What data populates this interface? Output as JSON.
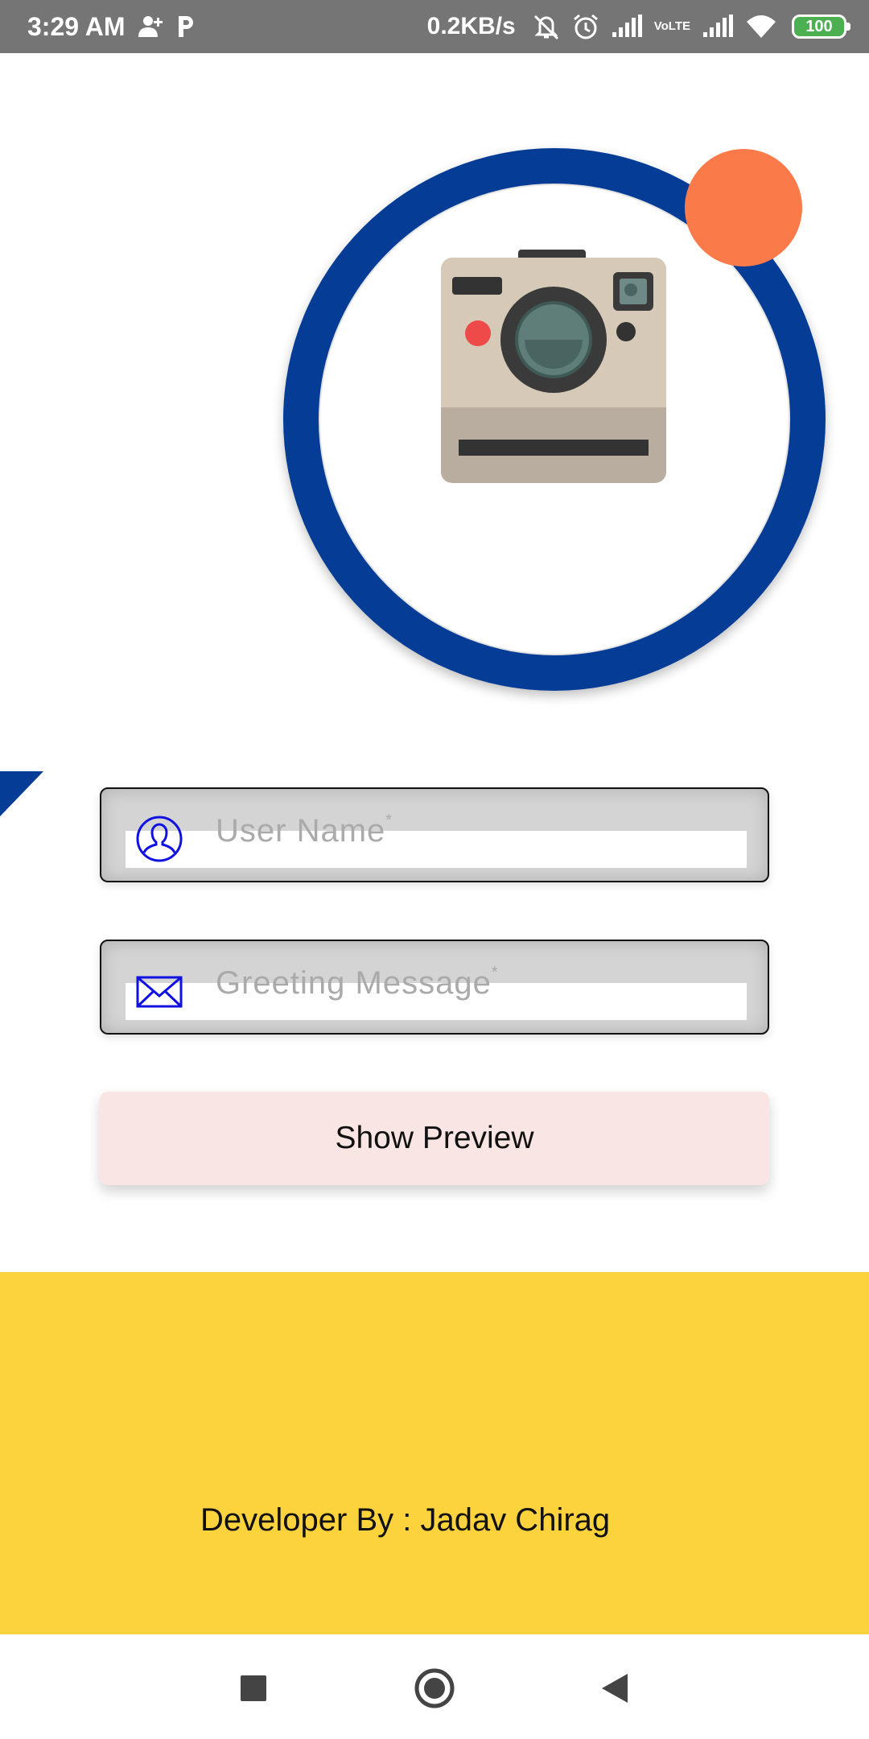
{
  "status_bar": {
    "time": "3:29 AM",
    "network_speed": "0.2KB/s",
    "volte_line1": "Vo",
    "volte_line2": "LTE",
    "battery": "100",
    "icons": [
      "add-user-icon",
      "p-icon",
      "mute-icon",
      "alarm-icon",
      "signal-icon",
      "volte-icon",
      "signal-icon",
      "wifi-icon",
      "battery-icon"
    ]
  },
  "hero": {
    "image": "camera-illustration",
    "colors": {
      "ring": "#053c96",
      "dot": "#fb7a4a"
    }
  },
  "form": {
    "username": {
      "placeholder": "User Name",
      "required_mark": "*",
      "icon": "user-icon"
    },
    "greeting": {
      "placeholder": "Greeting Message",
      "required_mark": "*",
      "icon": "mail-icon"
    },
    "preview_button": "Show Preview"
  },
  "footer": {
    "credit": "Developer By : Jadav Chirag",
    "color": "#fdd33d"
  },
  "nav_bar": {
    "buttons": [
      "recent-apps-icon",
      "home-icon",
      "back-icon"
    ]
  }
}
